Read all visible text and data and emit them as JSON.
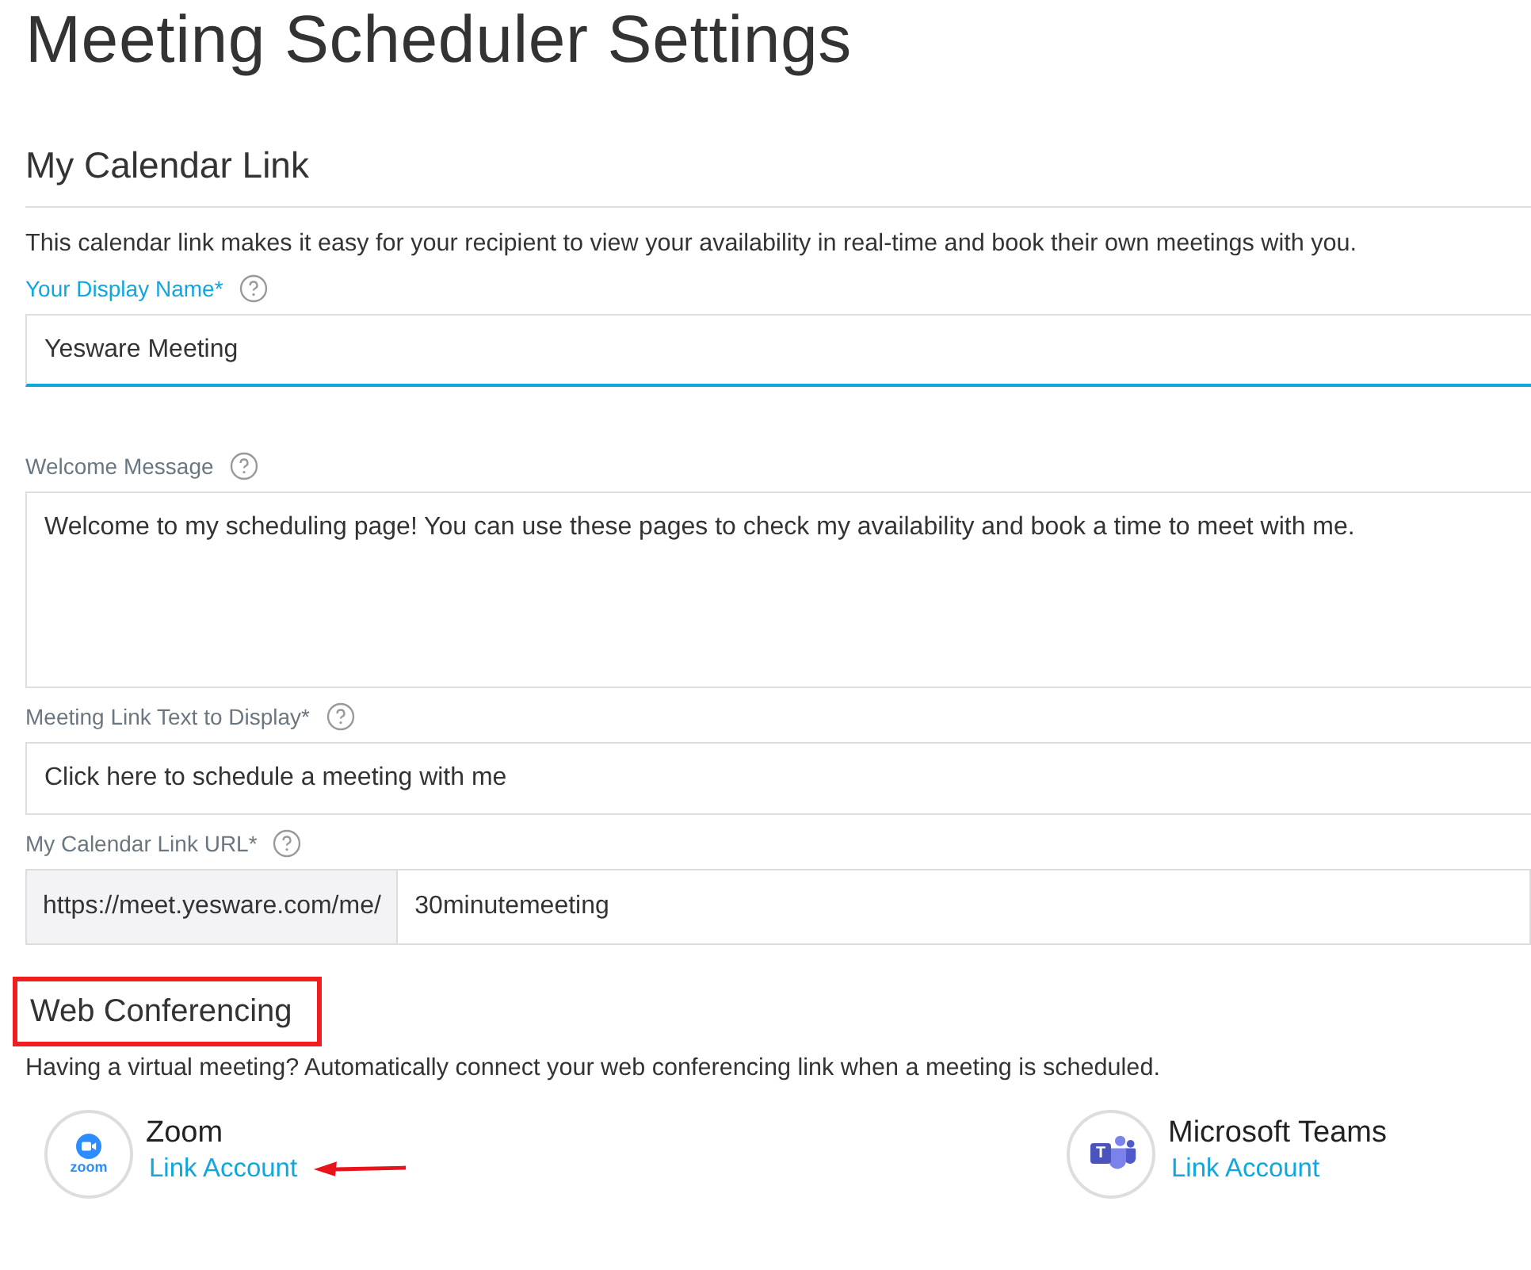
{
  "page_title": "Meeting Scheduler Settings",
  "calendar_section": {
    "heading": "My Calendar Link",
    "description": "This calendar link makes it easy for your recipient to view your availability in real-time and book their own meetings with you.",
    "fields": [
      {
        "kind": "input",
        "label": "Your Display Name*",
        "value": "Yesware Meeting",
        "focused": true
      },
      {
        "kind": "textarea",
        "label": "Welcome Message",
        "value": "Welcome to my scheduling page! You can use these pages to check my availability and book a time to meet with me.",
        "focused": false
      },
      {
        "kind": "input",
        "label": "Meeting Link Text to Display*",
        "value": "Click here to schedule a meeting with me",
        "focused": false
      },
      {
        "kind": "url",
        "label": "My Calendar Link URL*",
        "prefix": "https://meet.yesware.com/me/",
        "value": "30minutemeeting",
        "focused": false
      }
    ]
  },
  "conferencing_section": {
    "heading": "Web Conferencing",
    "highlighted": true,
    "description": "Having a virtual meeting? Automatically connect your web conferencing link when a meeting is scheduled.",
    "integrations": [
      {
        "kind": "zoom",
        "logo_text": "zoom",
        "name": "Zoom",
        "link": "Link Account",
        "arrow": true
      },
      {
        "kind": "teams",
        "logo_text": "T",
        "name": "Microsoft Teams",
        "link": "Link Account",
        "arrow": false
      }
    ]
  }
}
